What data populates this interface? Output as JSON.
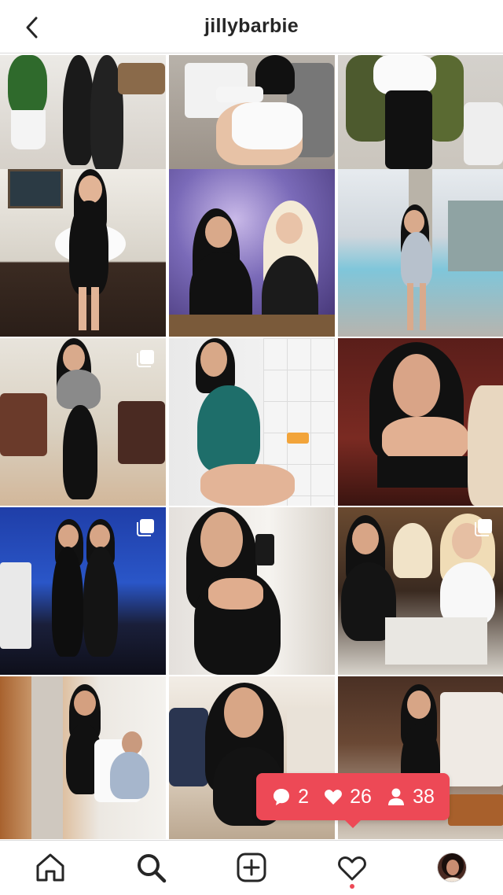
{
  "header": {
    "username": "jillybarbie",
    "back_icon": "chevron-left-icon"
  },
  "grid": {
    "rows": 5,
    "columns": 3,
    "posts": [
      {
        "type": "photo"
      },
      {
        "type": "photo"
      },
      {
        "type": "photo"
      },
      {
        "type": "photo"
      },
      {
        "type": "photo"
      },
      {
        "type": "photo"
      },
      {
        "type": "carousel"
      },
      {
        "type": "photo"
      },
      {
        "type": "photo"
      },
      {
        "type": "carousel"
      },
      {
        "type": "photo"
      },
      {
        "type": "carousel"
      },
      {
        "type": "photo"
      },
      {
        "type": "photo"
      },
      {
        "type": "photo"
      }
    ]
  },
  "activity_popup": {
    "comments": "2",
    "likes": "26",
    "follows": "38",
    "background": "#ed4956"
  },
  "tabbar": {
    "items": [
      "home-icon",
      "search-icon",
      "new-post-icon",
      "activity-icon",
      "profile-avatar"
    ],
    "notification_dot_color": "#ed4956"
  }
}
